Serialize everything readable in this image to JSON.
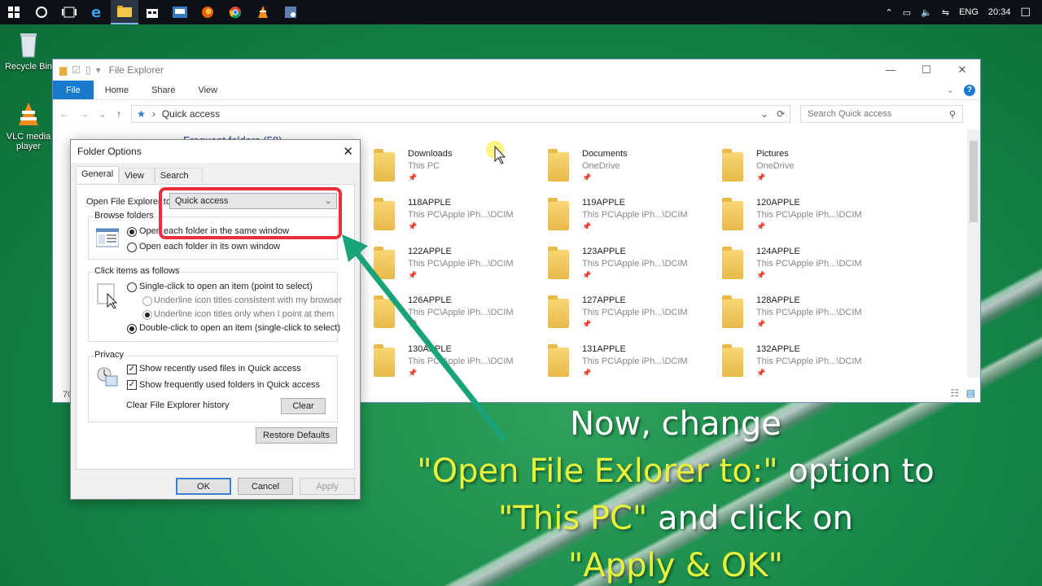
{
  "taskbar": {
    "icons": [
      "windows-start-icon",
      "cortana-circle-icon",
      "task-view-icon",
      "edge-icon",
      "file-explorer-icon",
      "store-icon",
      "app-icon",
      "firefox-icon",
      "chrome-icon",
      "vlc-icon",
      "tool-icon"
    ],
    "tray": {
      "lang": "ENG",
      "time": "20:34"
    }
  },
  "desktop": {
    "recycle_bin": "Recycle Bin",
    "vlc": "VLC media player"
  },
  "explorer": {
    "title": "File Explorer",
    "ribbon_tabs": [
      "File",
      "Home",
      "Share",
      "View"
    ],
    "address": "Quick access",
    "search_placeholder": "Search Quick access",
    "section_label": "Frequent folders (58)",
    "items_count": "70",
    "items": [
      {
        "name": "Downloads",
        "loc": "This PC"
      },
      {
        "name": "Documents",
        "loc": "OneDrive"
      },
      {
        "name": "Pictures",
        "loc": "OneDrive"
      },
      {
        "name": "118APPLE",
        "loc": "This PC\\Apple iPh...\\DCIM"
      },
      {
        "name": "119APPLE",
        "loc": "This PC\\Apple iPh...\\DCIM"
      },
      {
        "name": "120APPLE",
        "loc": "This PC\\Apple iPh...\\DCIM"
      },
      {
        "name": "122APPLE",
        "loc": "This PC\\Apple iPh...\\DCIM"
      },
      {
        "name": "123APPLE",
        "loc": "This PC\\Apple iPh...\\DCIM"
      },
      {
        "name": "124APPLE",
        "loc": "This PC\\Apple iPh...\\DCIM"
      },
      {
        "name": "126APPLE",
        "loc": "This PC\\Apple iPh...\\DCIM"
      },
      {
        "name": "127APPLE",
        "loc": "This PC\\Apple iPh...\\DCIM"
      },
      {
        "name": "128APPLE",
        "loc": "This PC\\Apple iPh...\\DCIM"
      },
      {
        "name": "130APPLE",
        "loc": "This PC\\Apple iPh...\\DCIM"
      },
      {
        "name": "131APPLE",
        "loc": "This PC\\Apple iPh...\\DCIM"
      },
      {
        "name": "132APPLE",
        "loc": "This PC\\Apple iPh...\\DCIM"
      }
    ]
  },
  "dialog": {
    "title": "Folder Options",
    "tabs": [
      "General",
      "View",
      "Search"
    ],
    "open_to_label": "Open File Explorer to:",
    "open_to_value": "Quick access",
    "browse_folders": {
      "title": "Browse folders",
      "same_window": "Open each folder in the same window",
      "own_window": "Open each folder in its own window"
    },
    "click_items": {
      "title": "Click items as follows",
      "single": "Single-click to open an item (point to select)",
      "underline_consistent": "Underline icon titles consistent with my browser",
      "underline_point": "Underline icon titles only when I point at them",
      "double": "Double-click to open an item (single-click to select)"
    },
    "privacy": {
      "title": "Privacy",
      "recent_files": "Show recently used files in Quick access",
      "frequent_folders": "Show frequently used folders in Quick access",
      "clear_history": "Clear File Explorer history",
      "clear_btn": "Clear"
    },
    "restore_btn": "Restore Defaults",
    "ok_btn": "OK",
    "cancel_btn": "Cancel",
    "apply_btn": "Apply"
  },
  "caption": {
    "line1": "Now, change",
    "line2_quote": "\"Open File Exlorer to:\"",
    "line2_rest": " option to",
    "line3_quote": "\"This PC\"",
    "line3_rest": " and click on",
    "line4": "\"Apply & OK\""
  },
  "colors": {
    "accent": "#1979ca",
    "highlight": "#ea2e3a",
    "arrow": "#1aa37a",
    "caption_yellow": "#e7f23b"
  }
}
